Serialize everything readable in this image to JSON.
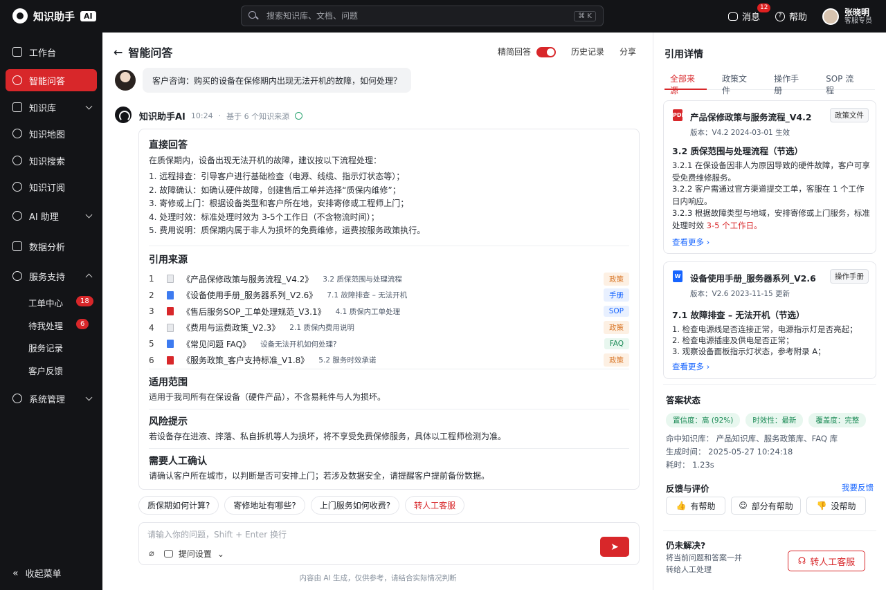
{
  "app": {
    "name": "知识助手",
    "badge": "AI"
  },
  "search": {
    "placeholder": "搜索知识库、文档、问题",
    "shortcut": "⌘ K"
  },
  "topbar": {
    "messages_label": "消息",
    "messages_count": "12",
    "help_label": "帮助",
    "user_name": "张晓明",
    "user_role": "客服专员"
  },
  "sidebar": {
    "items": [
      {
        "label": "工作台",
        "icon": "home-icon"
      },
      {
        "label": "智能问答",
        "icon": "chat-icon"
      },
      {
        "label": "知识库",
        "icon": "book-icon"
      },
      {
        "label": "知识地图",
        "icon": "graph-icon"
      },
      {
        "label": "知识搜索",
        "icon": "search-icon"
      },
      {
        "label": "知识订阅",
        "icon": "subscribe-icon"
      },
      {
        "label": "AI 助理",
        "icon": "ai-icon"
      },
      {
        "label": "数据分析",
        "icon": "chart-icon"
      },
      {
        "label": "服务支持",
        "icon": "gear-icon"
      },
      {
        "label": "系统管理",
        "icon": "settings-icon"
      }
    ],
    "sub_items": [
      {
        "label": "工单中心",
        "badge": "18"
      },
      {
        "label": "待我处理",
        "badge": "6"
      },
      {
        "label": "服务记录"
      },
      {
        "label": "客户反馈"
      }
    ],
    "collapse_label": "收起菜单"
  },
  "chat": {
    "title": "智能问答",
    "concise_label": "精简回答",
    "history_label": "历史记录",
    "share_label": "分享",
    "question": "客户咨询：购买的设备在保修期内出现无法开机的故障，如何处理？",
    "bot_name": "知识助手AI",
    "bot_time": "10:24",
    "bot_sources": "基于 6 个知识来源",
    "answer": {
      "direct_title": "直接回答",
      "intro": "在质保期内，设备出现无法开机的故障，建议按以下流程处理：",
      "steps": [
        "1.  远程排查：引导客户进行基础检查（电源、线缆、指示灯状态等）；",
        "2.  故障确认：如确认硬件故障，创建售后工单并选择“质保内维修”；",
        "3.  寄修或上门：根据设备类型和客户所在地，安排寄修或工程师上门；",
        "4.  处理时效：标准处理时效为  3-5个工作日（不含物流时间）；",
        "5.  费用说明：质保期内属于非人为损坏的免费维修，运费按服务政策执行。"
      ],
      "refs_title": "引用来源",
      "refs": [
        {
          "num": "1",
          "title": "《产品保修政策与服务流程_V4.2》",
          "section": "3.2 质保范围与处理流程",
          "tag": "政策",
          "type": "file"
        },
        {
          "num": "2",
          "title": "《设备使用手册_服务器系列_V2.6》",
          "section": "7.1 故障排查 – 无法开机",
          "tag": "手册",
          "type": "doc"
        },
        {
          "num": "3",
          "title": "《售后服务SOP_工单处理规范_V3.1》",
          "section": "4.1 质保内工单处理",
          "tag": "SOP",
          "type": "pdf"
        },
        {
          "num": "4",
          "title": "《费用与运费政策_V2.3》",
          "section": "2.1 质保内费用说明",
          "tag": "政策",
          "type": "file"
        },
        {
          "num": "5",
          "title": "《常见问题 FAQ》",
          "section": "设备无法开机如何处理?",
          "tag": "FAQ",
          "type": "doc"
        },
        {
          "num": "6",
          "title": "《服务政策_客户支持标准_V1.8》",
          "section": "5.2 服务时效承诺",
          "tag": "政策",
          "type": "pdf"
        }
      ],
      "scope_title": "适用范围",
      "scope_text": "适用于我司所有在保设备（硬件产品），不含易耗件与人为损坏。",
      "risk_title": "风险提示",
      "risk_text": "若设备存在进液、摔落、私自拆机等人为损坏，将不享受免费保修服务，具体以工程师检测为准。",
      "confirm_title": "需要人工确认",
      "confirm_text": "请确认客户所在城市，以判断是否可安排上门；若涉及数据安全，请提醒客户提前备份数据。"
    },
    "suggestions": [
      "质保期如何计算?",
      "寄修地址有哪些?",
      "上门服务如何收费?",
      "转人工客服"
    ],
    "input_placeholder": "请输入你的问题，Shift + Enter 换行",
    "settings_label": "提问设置",
    "footnote": "内容由 AI 生成，仅供参考，请结合实际情况判断"
  },
  "refs_panel": {
    "title": "引用详情",
    "tabs": [
      "全部来源",
      "政策文件",
      "操作手册",
      "SOP 流程"
    ],
    "card1": {
      "name": "产品保修政策与服务流程_V4.2",
      "tag": "政策文件",
      "meta": "版本：V4.2      2024-03-01 生效",
      "section": "3.2  质保范围与处理流程（节选）",
      "p1": "3.2.1 在保设备因非人为原因导致的硬件故障，客户可享受免费维修服务。",
      "p2": "3.2.2 客户需通过官方渠道提交工单，客服在 1 个工作日内响应。",
      "p3a": "3.2.3 根据故障类型与地域，安排寄修或上门服务，标准处理时效 ",
      "p3b": "3-5 个工作日。",
      "more": "查看更多"
    },
    "card2": {
      "name": "设备使用手册_服务器系列_V2.6",
      "tag": "操作手册",
      "meta": "版本：V2.6      2023-11-15 更新",
      "section": "7.1  故障排查 – 无法开机（节选）",
      "l1": "1.  检查电源线是否连接正常，电源指示灯是否亮起；",
      "l2": "2.  检查电源插座及供电是否正常；",
      "l3": "3.  观察设备面板指示灯状态，参考附录 A；",
      "more": "查看更多"
    },
    "status": {
      "title": "答案状态",
      "pills": [
        "置信度：高 (92%)",
        "时效性：最新",
        "覆盖度：完整"
      ],
      "hit": "命中知识库：  产品知识库、服务政策库、FAQ 库",
      "gen": "生成时间：  2025-05-27 10:24:18",
      "cost": "耗时：  1.23s"
    },
    "feedback": {
      "title": "反馈与评价",
      "link": "我要反馈",
      "buttons": [
        "有帮助",
        "部分有帮助",
        "没帮助"
      ]
    },
    "unsolved": {
      "title": "仍未解决?",
      "desc": "将当前问题和答案一并转给人工处理",
      "button": "转人工客服"
    }
  },
  "colors": {
    "accent": "#d8272a",
    "sidebar_bg": "#131417",
    "link": "#1664ff"
  }
}
